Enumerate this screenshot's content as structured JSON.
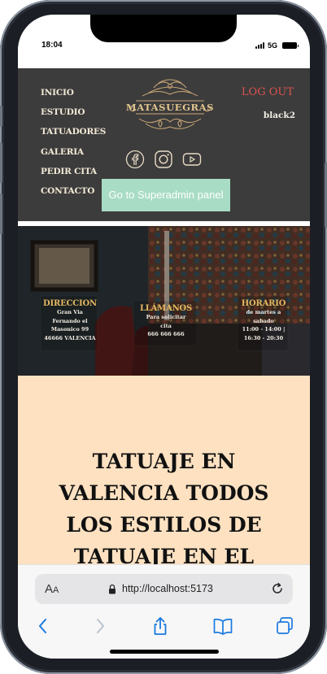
{
  "status_bar": {
    "time": "18:04",
    "network": "5G"
  },
  "header": {
    "nav": [
      "INICIO",
      "ESTUDIO",
      "TATUADORES",
      "GALERIA",
      "PEDIR CITA",
      "CONTACTO"
    ],
    "logo_text": "MATASUEGRAS",
    "logout_label": "LOG OUT",
    "username": "black2",
    "socials": [
      "facebook-icon",
      "instagram-icon",
      "youtube-icon"
    ],
    "admin_button": "Go to Superadmin panel"
  },
  "hero": {
    "direccion": {
      "title": "DIRECCION",
      "lines": [
        "Gran Via",
        "Fernando el",
        "Masonico 99",
        "46666 VALENCIA"
      ]
    },
    "llamanos": {
      "title": "LLÁMANOS",
      "lines": [
        "Para solicitar",
        "cita",
        "666 666 666"
      ]
    },
    "horario": {
      "title": "HORARIO",
      "lines": [
        "de martes a",
        "sabado",
        "11:00 - 14:00 |",
        "16:30 - 20:30"
      ]
    }
  },
  "content": {
    "headline_lines": [
      "TATUAJE EN",
      "VALENCIA TODOS",
      "LOS ESTILOS DE",
      "TATUAJE EN EL"
    ]
  },
  "browser": {
    "aa_label": "AA",
    "url": "http://localhost:5173"
  },
  "colors": {
    "header_bg": "#3d3c3c",
    "logout": "#d9534f",
    "admin_button_bg": "#a8dcc4",
    "hero_title": "#e3b862",
    "content_bg": "#fde1c1"
  }
}
